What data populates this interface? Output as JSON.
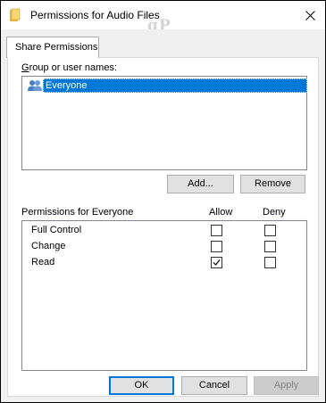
{
  "window": {
    "title": "Permissions for Audio Files",
    "watermark": "gP"
  },
  "tabs": [
    {
      "label": "Share Permissions",
      "active": true
    }
  ],
  "group_section": {
    "label": "Group or user names:",
    "users": [
      {
        "name": "Everyone",
        "selected": true
      }
    ],
    "add_label": "Add...",
    "remove_label": "Remove"
  },
  "permissions_section": {
    "label": "Permissions for Everyone",
    "allow_header": "Allow",
    "deny_header": "Deny",
    "rows": [
      {
        "name": "Full Control",
        "allow": false,
        "deny": false
      },
      {
        "name": "Change",
        "allow": false,
        "deny": false
      },
      {
        "name": "Read",
        "allow": true,
        "deny": false
      }
    ]
  },
  "footer": {
    "ok_label": "OK",
    "cancel_label": "Cancel",
    "apply_label": "Apply",
    "apply_enabled": false
  },
  "colors": {
    "selection": "#0078d7",
    "dialog_bg": "#f0f0f0",
    "button_bg": "#e1e1e1"
  }
}
